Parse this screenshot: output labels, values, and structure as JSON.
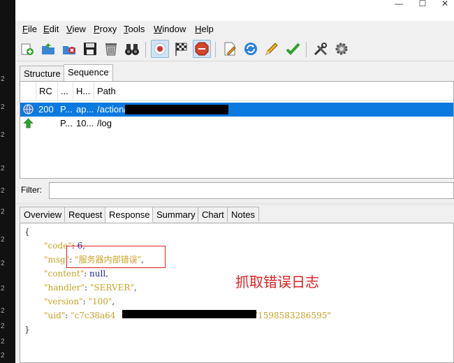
{
  "window": {
    "controls": {
      "minimize": "—",
      "maximize": "☐",
      "close": "✕"
    }
  },
  "menu": [
    {
      "label": "File",
      "mnemonic": "F",
      "rest": "ile"
    },
    {
      "label": "Edit",
      "mnemonic": "E",
      "rest": "dit"
    },
    {
      "label": "View",
      "mnemonic": "V",
      "rest": "iew"
    },
    {
      "label": "Proxy",
      "mnemonic": "P",
      "rest": "roxy"
    },
    {
      "label": "Tools",
      "mnemonic": "T",
      "rest": "ools"
    },
    {
      "label": "Window",
      "mnemonic": "W",
      "rest": "indow"
    },
    {
      "label": "Help",
      "mnemonic": "H",
      "rest": "elp"
    }
  ],
  "toolbar": {
    "icons": [
      "new-session-icon",
      "open-icon",
      "clear-icon",
      "save-icon",
      "trash-icon",
      "binoculars-icon",
      "record-icon",
      "checkered-flag-icon",
      "stop-icon",
      "edit-document-icon",
      "refresh-icon",
      "pencil-icon",
      "checkmark-icon",
      "tools-icon",
      "settings-gear-icon"
    ]
  },
  "upper_tabs": {
    "structure": "Structure",
    "sequence": "Sequence"
  },
  "table": {
    "headers": {
      "rc": "RC",
      "method": "...",
      "host": "H...",
      "path": "Path"
    },
    "rows": [
      {
        "rc": "200",
        "method": "P...",
        "host": "ap...",
        "path": "/action/",
        "selected": true,
        "icon": "globe-icon"
      },
      {
        "rc": "",
        "method": "P...",
        "host": "10...",
        "path": "/log",
        "selected": false,
        "icon": "upload-arrow-icon"
      }
    ]
  },
  "filter": {
    "label": "Filter:",
    "value": ""
  },
  "lower_tabs": {
    "overview": "Overview",
    "request": "Request",
    "response": "Response",
    "summary": "Summary",
    "chart": "Chart",
    "notes": "Notes"
  },
  "response": {
    "open": "{",
    "close": "}",
    "lines": [
      {
        "key": "\"code\"",
        "value": "6",
        "kind": "number"
      },
      {
        "key": "\"msg\"",
        "value": "\"服务器内部错误\"",
        "kind": "string"
      },
      {
        "key": "\"content\"",
        "value": "null",
        "kind": "number"
      },
      {
        "key": "\"handler\"",
        "value": "\"SERVER\"",
        "kind": "string"
      },
      {
        "key": "\"version\"",
        "value": "\"100\"",
        "kind": "string"
      },
      {
        "key": "\"uid\"",
        "value": "\"c7c38a64",
        "tail": "71598583286595\"",
        "kind": "string"
      }
    ]
  },
  "annotation": {
    "text": "抓取错误日志",
    "color": "#e02020"
  },
  "colors": {
    "selection": "#0a7ae0",
    "json_key": "#c9a227",
    "json_number": "#1a1aa6"
  },
  "desktop_numbers": [
    "2",
    "2",
    "2",
    "2",
    "2",
    "2",
    "2",
    "2",
    "2",
    "2",
    "2",
    "2",
    "2"
  ]
}
